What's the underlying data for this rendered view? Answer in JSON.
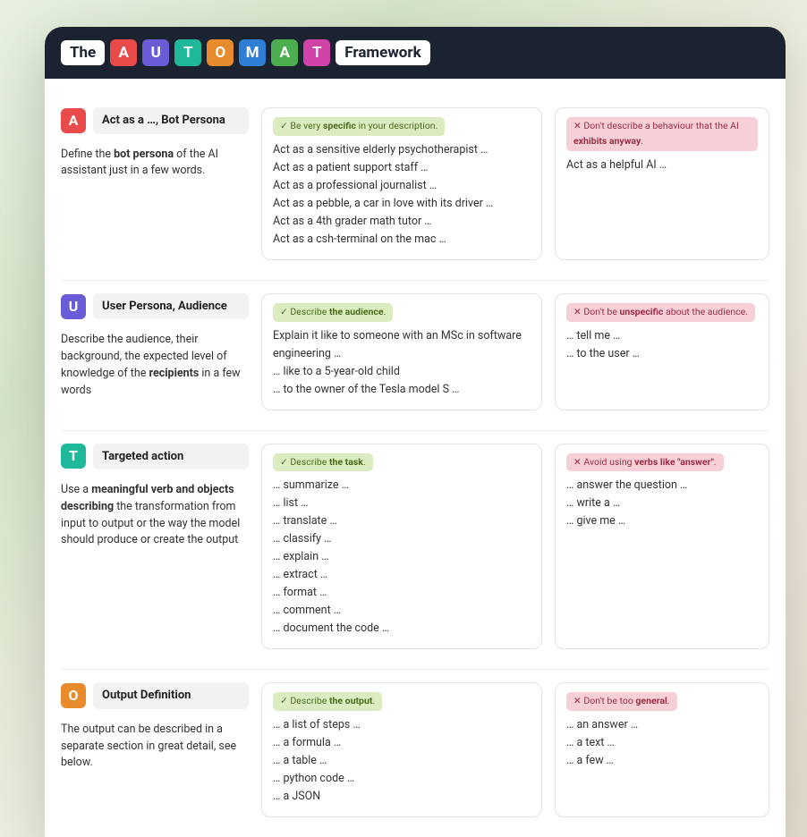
{
  "header": {
    "prefix": "The",
    "letters": [
      "A",
      "U",
      "T",
      "O",
      "M",
      "A",
      "T"
    ],
    "letter_colors": [
      "c-red",
      "c-purple",
      "c-teal",
      "c-orange",
      "c-blue",
      "c-green",
      "c-pink"
    ],
    "suffix": "Framework"
  },
  "rows": [
    {
      "letter": "A",
      "letter_color": "c-red",
      "title": "Act as a …, Bot Persona",
      "desc_html": "Define the <b>bot persona</b> of the AI assistant just in a few words.",
      "good_badge_html": "Be very <b>specific</b> in your description.",
      "good_examples": "Act as a sensitive elderly psychotherapist …\nAct as a patient support staff …\nAct as a professional journalist …\nAct as a pebble, a car in love with its driver …\nAct as a 4th grader math tutor …\nAct as a csh-terminal on the mac …",
      "bad_badge_html": "Don't describe a behaviour that the AI <b>exhibits anyway</b>.",
      "bad_examples": "Act as a helpful AI …"
    },
    {
      "letter": "U",
      "letter_color": "c-purple",
      "title": "User Persona, Audience",
      "desc_html": "Describe the audience, their background, the expected level of knowledge of the <b>recipients</b> in a few words",
      "good_badge_html": "Describe <b>the audience</b>.",
      "good_examples": "Explain it like to someone with an MSc in software engineering …\n… like to a 5-year-old child\n… to the owner of the Tesla model S …",
      "bad_badge_html": "Don't be <b>unspecific</b> about the audience.",
      "bad_examples": "… tell me …\n… to the user …"
    },
    {
      "letter": "T",
      "letter_color": "c-teal",
      "title": "Targeted action",
      "desc_html": "Use a <b>meaningful verb and objects describing</b> the transformation from input to output or the way the model should produce or create the output",
      "good_badge_html": "Describe <b>the task</b>.",
      "good_examples": "… summarize …\n… list …\n… translate …\n… classify …\n… explain …\n… extract …\n… format …\n… comment …\n… document the code …",
      "bad_badge_html": "Avoid using <b>verbs like \"answer\"</b>.",
      "bad_examples": "… answer the question …\n… write a …\n… give me …"
    },
    {
      "letter": "O",
      "letter_color": "c-orange",
      "title": "Output Definition",
      "desc_html": "The output can be described in a separate section in great detail, see below.",
      "good_badge_html": "Describe <b>the output</b>.",
      "good_examples": "… a list of steps …\n… a formula …\n… a table …\n… python code …\n… a JSON",
      "bad_badge_html": "Don't be too <b>general</b>.",
      "bad_examples": "… an answer …\n… a text …\n… a few …"
    }
  ]
}
